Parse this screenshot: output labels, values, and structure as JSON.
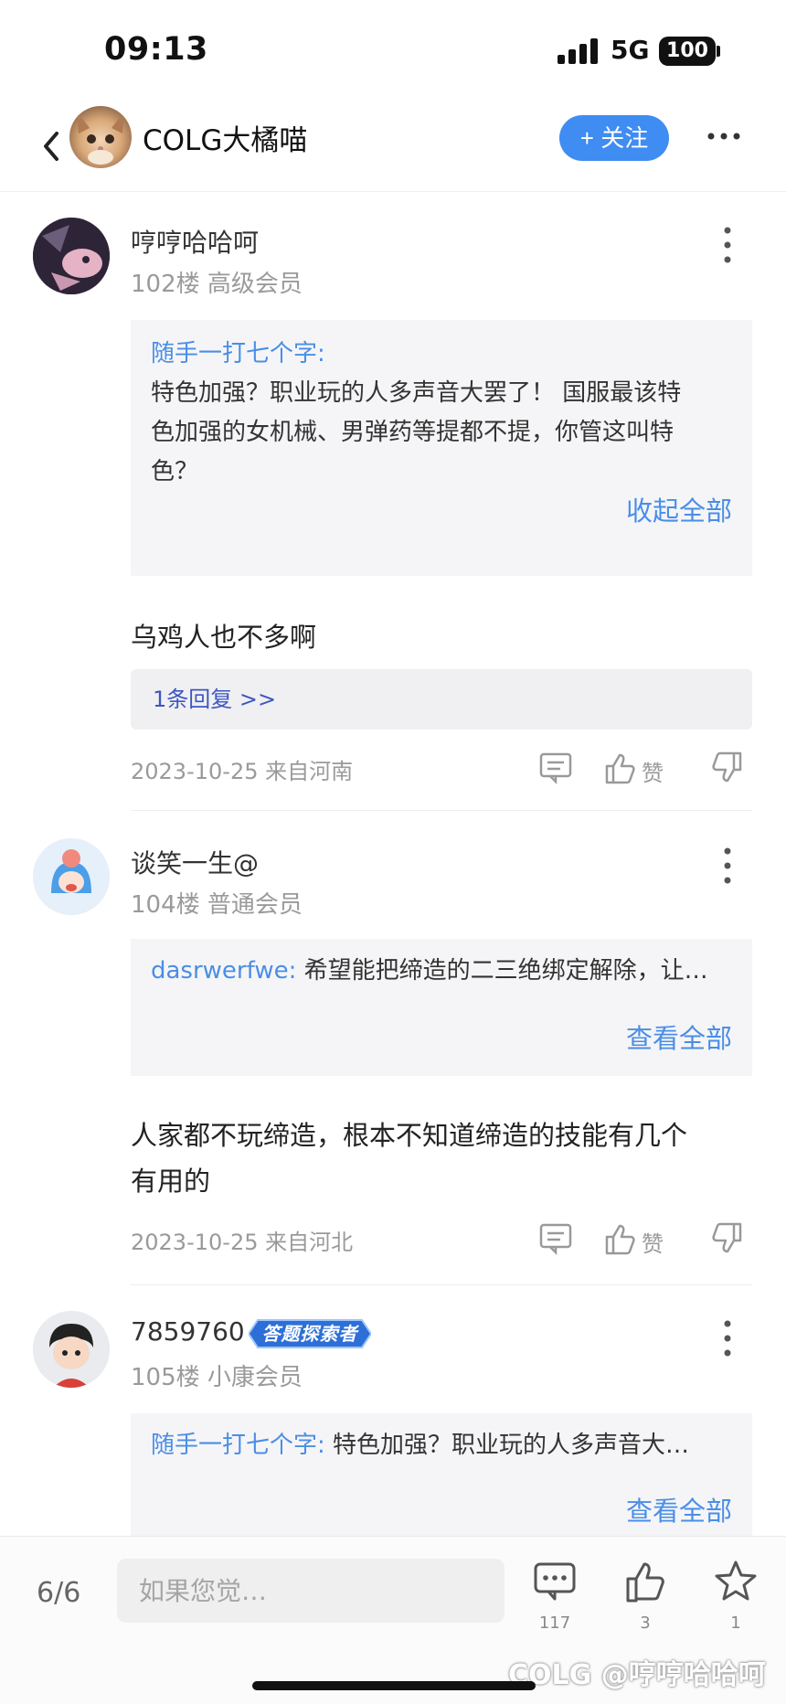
{
  "status_bar": {
    "time": "09:13",
    "network": "5G",
    "battery": "100"
  },
  "header": {
    "title": "COLG大橘喵",
    "follow_label": "+ 关注"
  },
  "comments": [
    {
      "username": "哼哼哈哈呵",
      "floor": "102楼",
      "level": "高级会员",
      "quote_name": "随手一打七个字:",
      "quote_lines": [
        "特色加强？职业玩的人多声音大罢了！ 国服最该特",
        "色加强的女机械、男弹药等提都不提，你管这叫特",
        "色？"
      ],
      "quote_link": "收起全部",
      "reply_lines": [
        "乌鸡人也不多啊"
      ],
      "replies_link": "1条回复 >>",
      "date_location": "2023-10-25 来自河南",
      "like_label": "赞"
    },
    {
      "username": "谈笑一生@",
      "floor": "104楼",
      "level": "普通会员",
      "quote_name": "dasrwerfwe:",
      "quote_text": " 希望能把缔造的二三绝绑定解除，让…",
      "quote_link": "查看全部",
      "reply_lines": [
        "人家都不玩缔造，根本不知道缔造的技能有几个",
        "有用的"
      ],
      "date_location": "2023-10-25 来自河北",
      "like_label": "赞"
    },
    {
      "username": "7859760",
      "badge": "答题探索者",
      "floor": "105楼",
      "level": "小康会员",
      "quote_name": "随手一打七个字:",
      "quote_text": " 特色加强？职业玩的人多声音大…",
      "quote_link": "查看全部"
    }
  ],
  "bottom_bar": {
    "page_indicator": "6/6",
    "input_placeholder": "如果您觉…",
    "comment_count": "117",
    "like_count": "3",
    "favorite_count": "1"
  },
  "watermark": "COLG @哼哼哈哈呵",
  "icons": [
    "back-icon",
    "more-icon",
    "vertical-more-icon",
    "comment-icon",
    "thumb-up-icon",
    "thumb-down-icon",
    "star-icon"
  ],
  "colors": {
    "accent": "#3f8cf2",
    "link": "#4a8ee6",
    "reply_link": "#3d56c2",
    "muted": "#9a9a9a"
  }
}
